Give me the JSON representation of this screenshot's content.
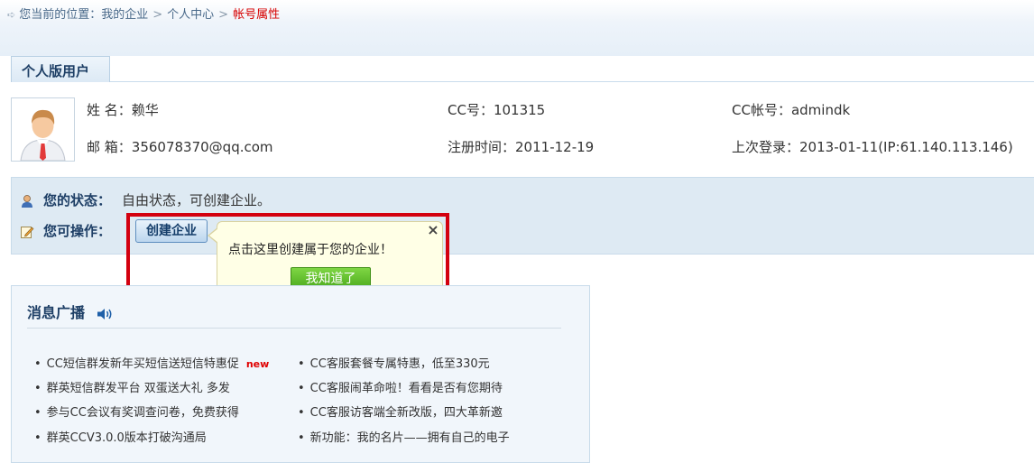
{
  "breadcrumb": {
    "prefix": "您当前的位置：",
    "items": [
      "我的企业",
      "个人中心"
    ],
    "current": "帐号属性",
    "separator": ">"
  },
  "tab": {
    "label": "个人版用户"
  },
  "profile": {
    "name_label": "姓 名：",
    "name_value": "赖华",
    "email_label": "邮 箱：",
    "email_value": "356078370@qq.com",
    "cc_number_label": "CC号：",
    "cc_number_value": "101315",
    "register_label": "注册时间：",
    "register_value": "2011-12-19",
    "cc_account_label": "CC帐号：",
    "cc_account_value": "admindk",
    "last_login_label": "上次登录：",
    "last_login_value": "2013-01-11(IP:61.140.113.146)"
  },
  "status": {
    "state_label": "您的状态：",
    "state_value": "自由状态，可创建企业。",
    "actions_label": "您可操作：",
    "create_button": "创建企业"
  },
  "popup": {
    "message": "点击这里创建属于您的企业！",
    "ok_button": "我知道了",
    "close": "×"
  },
  "news": {
    "title": "消息广播",
    "left": [
      "CC短信群发新年买短信送短信特惠促",
      "群英短信群发平台 双蛋送大礼 多发",
      "参与CC会议有奖调查问卷，免费获得",
      "群英CCV3.0.0版本打破沟通局"
    ],
    "new_tag": "new",
    "right": [
      "CC客服套餐专属特惠，低至330元",
      "CC客服闹革命啦！看看是否有您期待",
      "CC客服访客端全新改版，四大革新邀",
      "新功能：我的名片——拥有自己的电子"
    ]
  },
  "colors": {
    "accent": "#1e3f66",
    "highlight": "#d3000f",
    "breadcrumb_current": "#d60000",
    "ok_button": "#4fb01f"
  }
}
